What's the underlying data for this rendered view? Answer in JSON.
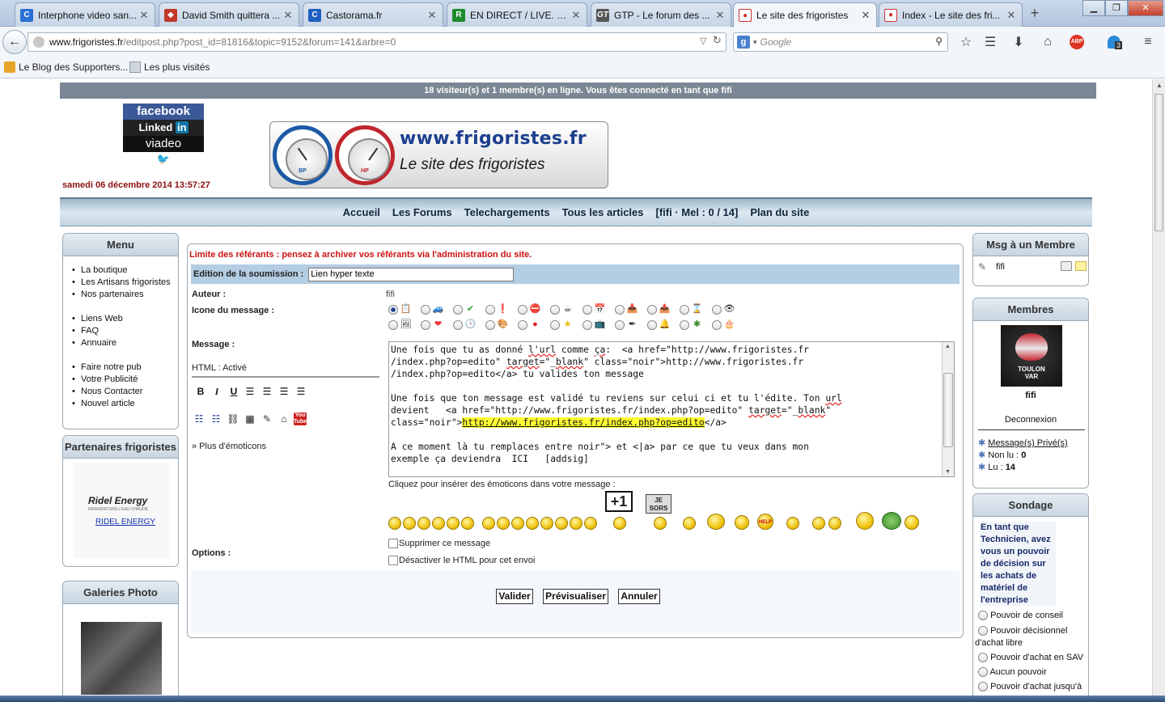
{
  "browser": {
    "tabs": [
      {
        "title": "Interphone video san...",
        "icon": "blue-c",
        "color": "#2a6fd6"
      },
      {
        "title": "David Smith quittera ...",
        "icon": "rct-shield",
        "color": "#c0392b"
      },
      {
        "title": "Castorama.fr",
        "icon": "castorama",
        "color": "#1f5fbf"
      },
      {
        "title": "EN DIRECT / LIVE. M...",
        "icon": "R",
        "color": "#1d8b2e"
      },
      {
        "title": "GTP - Le forum des ...",
        "icon": "GT",
        "color": "#555555"
      },
      {
        "title": "Le site des frigoristes",
        "icon": "frigo",
        "color": "#2a6fd6"
      },
      {
        "title": "Index - Le site des fri...",
        "icon": "frigo",
        "color": "#2a6fd6"
      }
    ],
    "url_host": "www.frigoristes.fr",
    "url_rest": "/editpost.php?post_id=81816&topic=9152&forum=141&arbre=0",
    "search_placeholder": "Google",
    "badge_count": "3",
    "bookmarks": [
      "Le Blog des Supporters...",
      "Les plus visités"
    ]
  },
  "page": {
    "status": "18 visiteur(s) et 1 membre(s) en ligne. Vous êtes connecté en tant que fifi",
    "datetime": "samedi 06 décembre 2014 13:57:27",
    "social": {
      "facebook": "facebook",
      "linkedin_a": "Linked",
      "linkedin_b": "in",
      "viadeo": "viadeo"
    },
    "banner": {
      "site": "www.frigoristes.fr",
      "tagline": "Le site des frigoristes",
      "bp": "BP",
      "hp": "HP"
    },
    "nav": [
      "Accueil",
      "Les Forums",
      "Telechargements",
      "Tous les articles",
      "[fifi · Mel : 0 / 14]",
      "Plan du site"
    ]
  },
  "menu": {
    "title": "Menu",
    "items": [
      "La boutique",
      "Les Artisans frigoristes",
      "Nos partenaires",
      "Liens Web",
      "FAQ",
      "Annuaire",
      "Faire notre pub",
      "Votre Publicité",
      "Nous Contacter",
      "Nouvel article"
    ]
  },
  "partners": {
    "title": "Partenaires frigoristes",
    "logo": "Ridel Energy",
    "logo_sub": "REINVENTONS L'EAU CHAUDE",
    "link": "RIDEL ENERGY"
  },
  "galleries": {
    "title": "Galeries Photo"
  },
  "form": {
    "warning": "Limite des référants : pensez à archiver vos référants via l'administration du site.",
    "edit_label": "Edition de la soumission :",
    "title_value": "Lien hyper texte",
    "author_label": "Auteur :",
    "author_value": "fifi",
    "icon_label": "Icone du message :",
    "message_label": "Message :",
    "html_status": "HTML : Activé",
    "more_emoticons": "» Plus d'émoticons",
    "emoticons_tip": "Cliquez pour insérer des émoticons dans votre message :",
    "options_label": "Options :",
    "opt_remove": "Supprimer ce message",
    "opt_nohtml": "Désactiver le HTML pour cet envoi",
    "btn_validate": "Valider",
    "btn_preview": "Prévisualiser",
    "btn_cancel": "Annuler",
    "message": {
      "p1a": "Une fois que tu as donné ",
      "p1b": "l'url",
      "p1c": " comme ",
      "p1d": "ça",
      "p1e": ":  <a href=\"http://www.frigoristes.fr\n/index.php?op=edito\" ",
      "p1f": "target",
      "p1g": "=\"_",
      "p1h": "blank",
      "p1i": "\" class=\"noir\">http://www.frigoristes.fr\n/index.php?op=edito</a> tu valides ton message\n\nUne fois que ton message est validé tu reviens sur celui ci et tu l'édite. Ton ",
      "p1j": "url",
      "p2a": "\ndevient   <a href=\"http://www.frigoristes.fr/index.php?op=edito\" ",
      "p2b": "target",
      "p2c": "=\"_",
      "p2d": "blank",
      "p2e": "\"\nclass=\"noir\">",
      "p2f": "http://www.frigoristes.fr/index.php?op=edito",
      "p2g": "</a>\n\nA ce moment là tu remplaces entre noir\"> et <|a> par ce que tu veux dans mon\nexemple ça deviendra  ICI   [addsig]"
    },
    "sign_plus": "+1",
    "sign_out_a": "JE",
    "sign_out_b": "SORS",
    "help": "HELP"
  },
  "right": {
    "msg_title": "Msg à un Membre",
    "msg_user": "fifi",
    "members_title": "Membres",
    "avatar_a": "TOULON",
    "avatar_b": "VAR",
    "member_name": "fifi",
    "logout": "Deconnexion",
    "pm": "Message(s) Privé(s)",
    "unread_label": "Non lu : ",
    "unread": "0",
    "read_label": "Lu : ",
    "read": "14",
    "poll_title": "Sondage",
    "poll_question": "En tant que Technicien, avez vous un pouvoir de décision sur les achats de matériel de l'entreprise",
    "poll_options": [
      "Pouvoir de conseil",
      "Pouvoir décisionnel d'achat libre",
      "Pouvoir d'achat en SAV",
      "Aucun pouvoir",
      "Pouvoir d'achat jusqu'à"
    ]
  },
  "colors": {
    "nav_text": "#11243a",
    "warning": "#cc1111",
    "datetime": "#8b1010",
    "highlight": "#ffff33"
  }
}
